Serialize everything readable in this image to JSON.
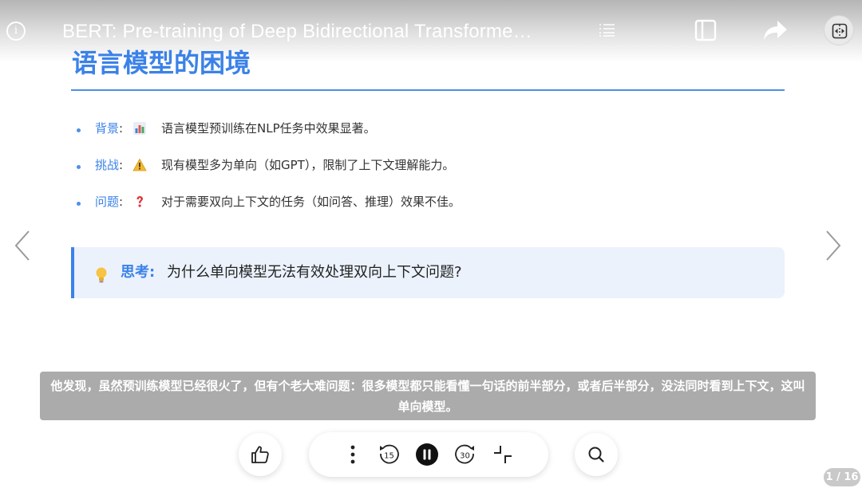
{
  "header": {
    "info_icon_glyph": "i",
    "document_title": "BERT: Pre-training of Deep Bidirectional Transforme…",
    "icons": [
      "info-icon",
      "list-icon",
      "sidebar-panel-icon",
      "share-arrow-icon",
      "split-compare-icon"
    ]
  },
  "slide": {
    "title": "语言模型的困境",
    "accent_color": "#3b82e8",
    "bullets": [
      {
        "label": "背景",
        "colon": ":",
        "icon": "bar-chart-icon",
        "text": "语言模型预训练在NLP任务中效果显著。"
      },
      {
        "label": "挑战",
        "colon": ":",
        "icon": "warning-icon",
        "text": "现有模型多为单向（如GPT），限制了上下文理解能力。"
      },
      {
        "label": "问题",
        "colon": ":",
        "icon": "question-mark-icon",
        "text": "对于需要双向上下文的任务（如问答、推理）效果不佳。"
      }
    ],
    "callout": {
      "icon": "lightbulb-icon",
      "label": "思考:",
      "text": "为什么单向模型无法有效处理双向上下文问题?"
    }
  },
  "navigation": {
    "prev_icon": "chevron-left-icon",
    "next_icon": "chevron-right-icon"
  },
  "subtitle": {
    "text": "他发现，虽然预训练模型已经很火了，但有个老大难问题：很多模型都只能看懂一句话的前半部分，或者后半部分，没法同时看到上下文，这叫单向模型。"
  },
  "player": {
    "rewind_seconds": "15",
    "forward_seconds": "30",
    "icons": [
      "thumbs-up-icon",
      "more-vertical-icon",
      "rewind-15-icon",
      "pause-icon",
      "forward-30-icon",
      "exit-fullscreen-icon",
      "search-icon"
    ]
  },
  "page_indicator": "1 / 16"
}
